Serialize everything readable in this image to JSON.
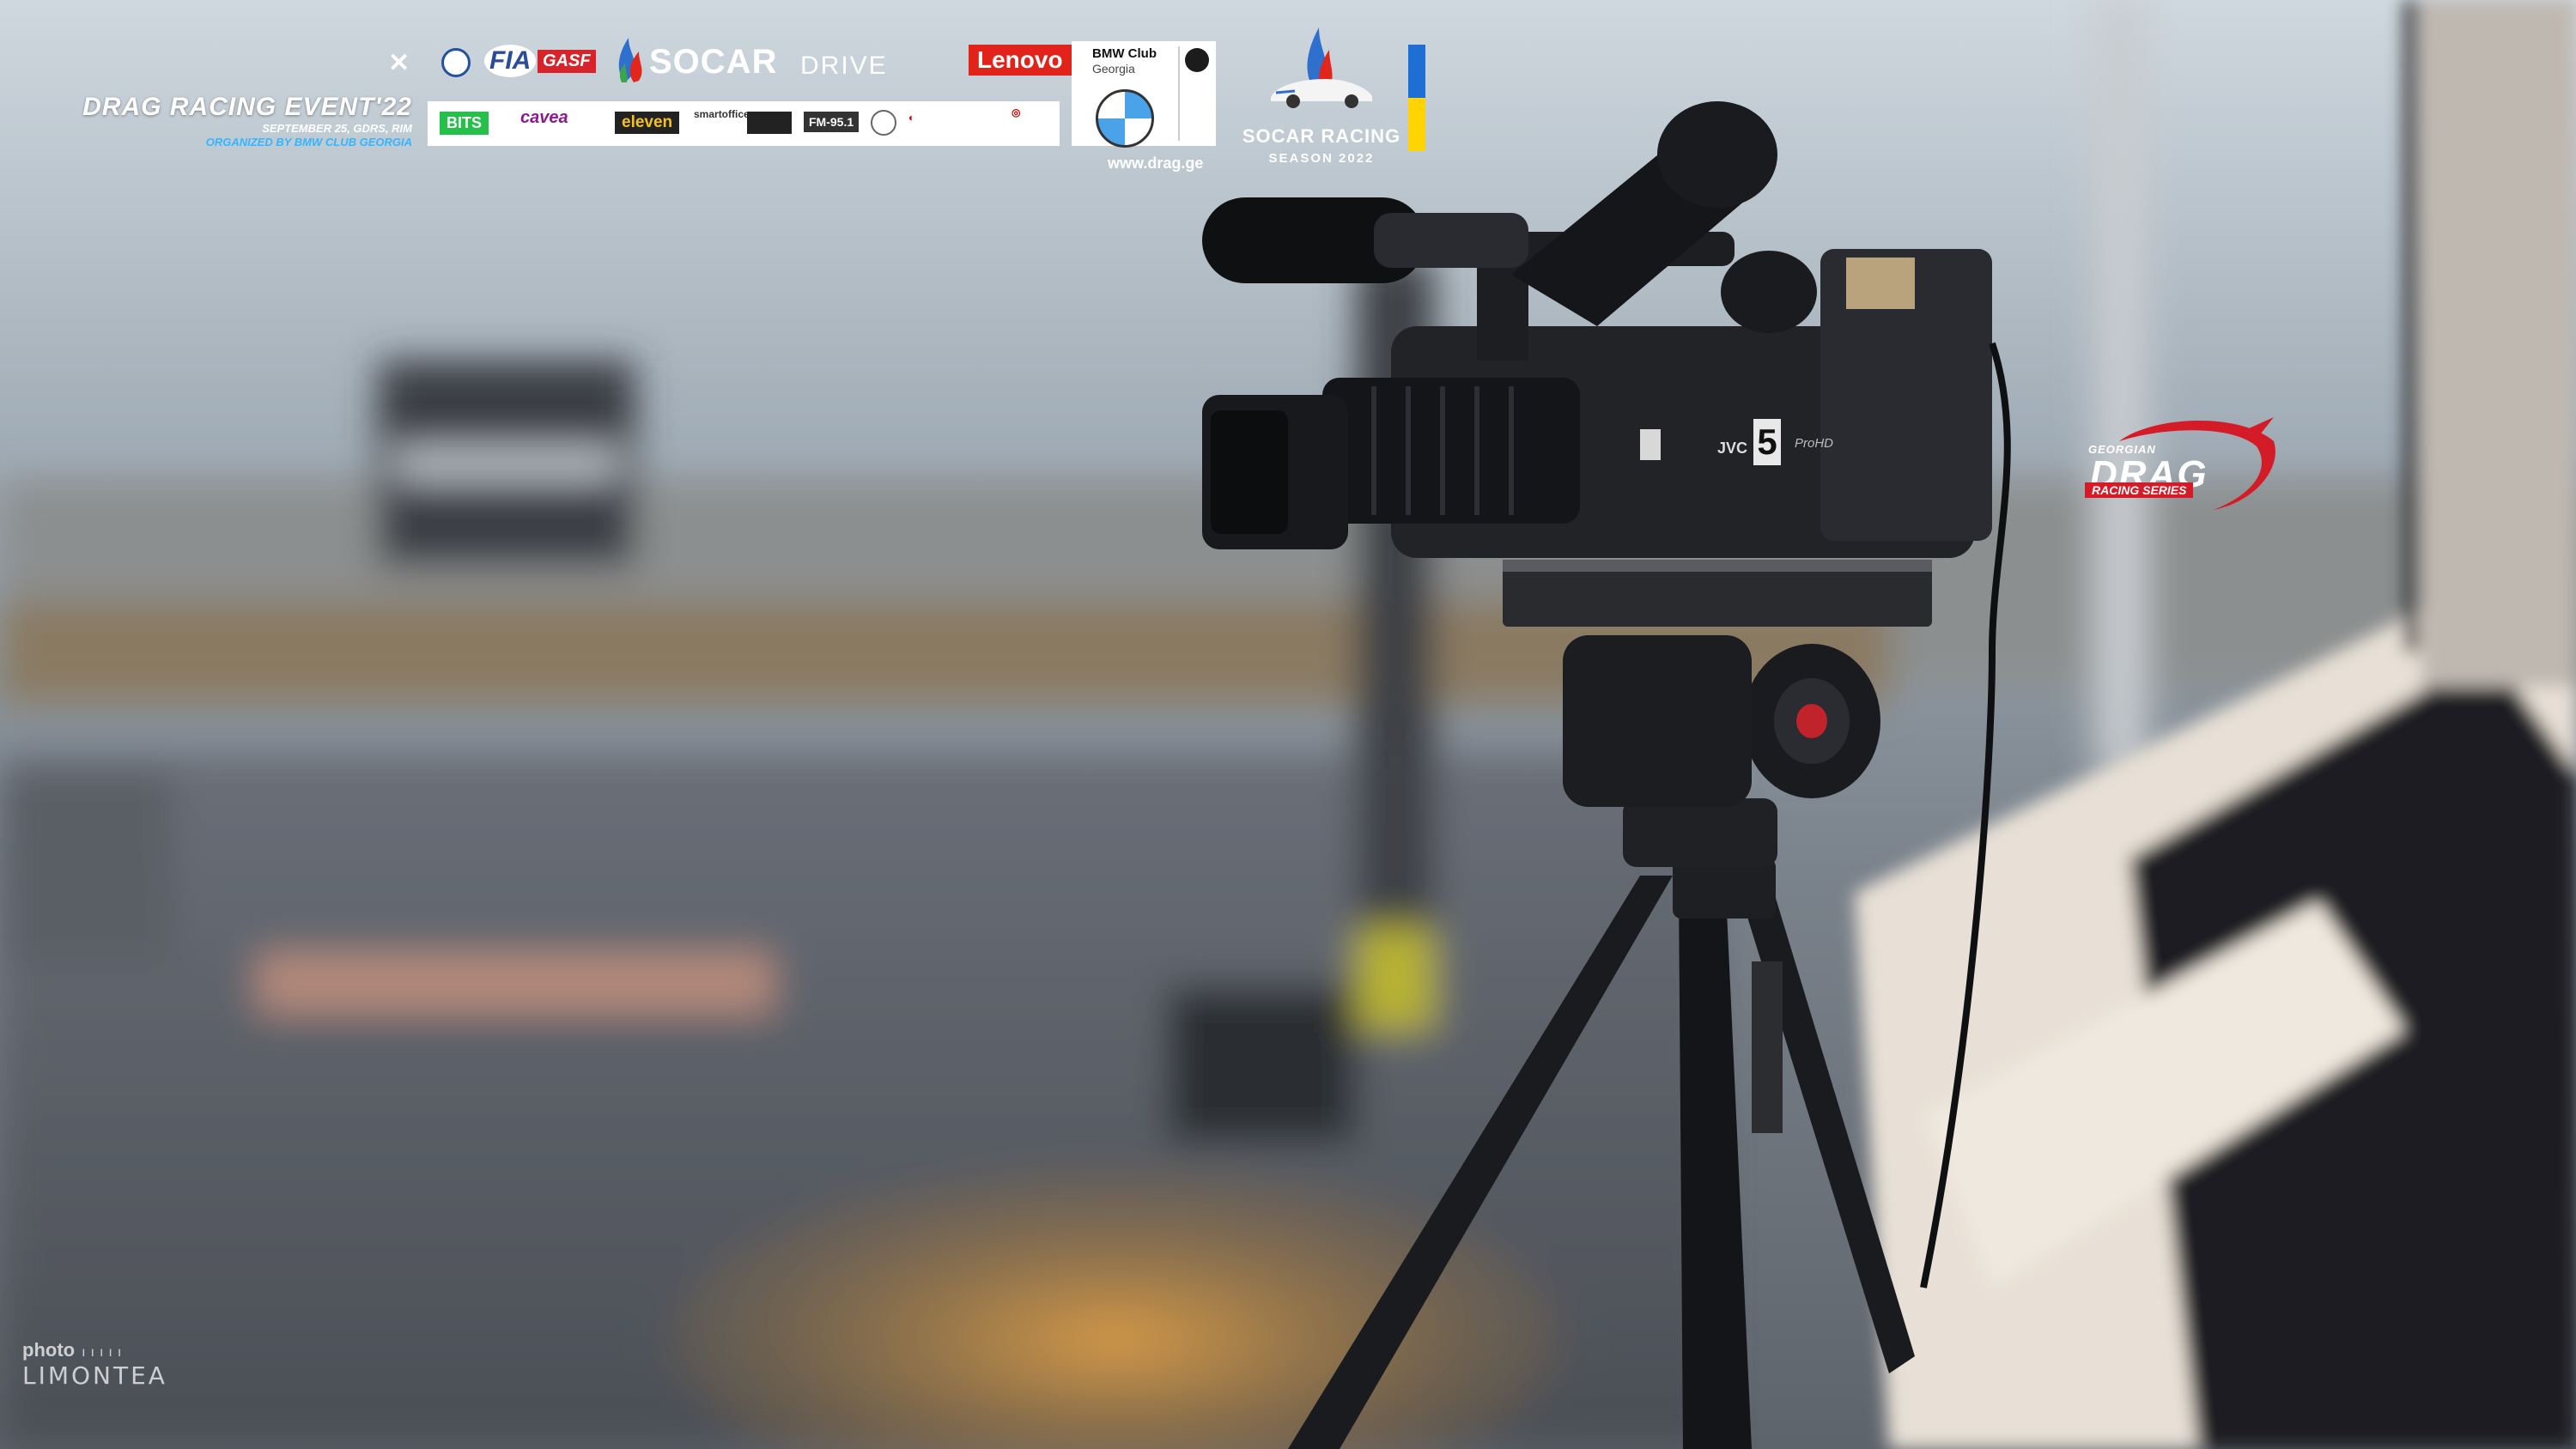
{
  "event": {
    "title": "DRAG RACING EVENT'22",
    "date_line": "SEPTEMBER 25, GDRS, RIM",
    "organizer_line": "ORGANIZED BY BMW CLUB GEORGIA"
  },
  "sponsors_top": {
    "fia": "FIA",
    "gasf": "GASF",
    "socar": "SOCAR",
    "drive": "DRIVE",
    "lenovo": "Lenovo"
  },
  "sponsor_strip": {
    "bits": "BITS",
    "cavea": "cavea",
    "eleven": "eleven",
    "smartoffice": "smartoffice.ge",
    "fm": "FM-95.1"
  },
  "bmw_club": {
    "line1": "BMW Club",
    "line2": "Georgia"
  },
  "site_url": "www.drag.ge",
  "socar_racing": {
    "title": "SOCAR RACING",
    "season": "SEASON 2022"
  },
  "drag_series": {
    "georgian": "GEORGIAN",
    "drag": "DRAG",
    "sub": "RACING SERIES"
  },
  "camera": {
    "brand": "JVC",
    "channel": "5",
    "model": "ProHD"
  },
  "watermark": {
    "photo": "photo",
    "name": "LIMONTEA"
  },
  "colors": {
    "accent_blue": "#36b4ff",
    "brand_red": "#d41b28",
    "ukraine_blue": "#1f6ed4",
    "ukraine_yellow": "#ffd400"
  }
}
